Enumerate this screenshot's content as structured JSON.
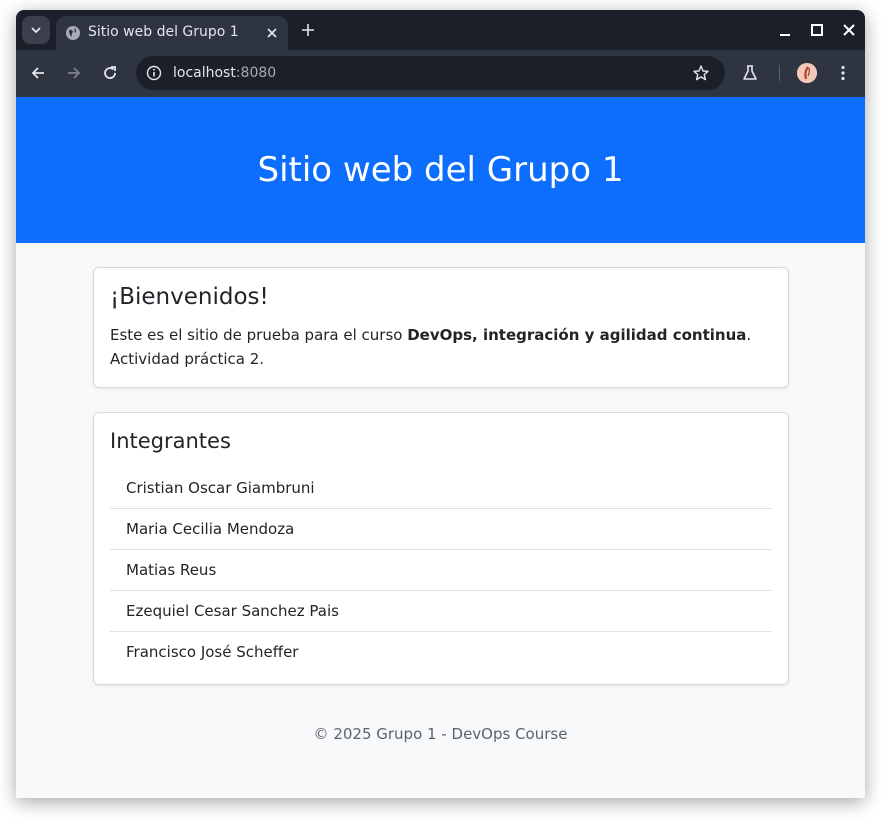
{
  "browser": {
    "tab": {
      "title": "Sitio web del Grupo 1"
    },
    "address": {
      "host": "localhost",
      "port": ":8080"
    }
  },
  "page": {
    "hero_title": "Sitio web del Grupo 1",
    "welcome": {
      "heading": "¡Bienvenidos!",
      "text_before": "Este es el sitio de prueba para el curso ",
      "course": "DevOps, integración y agilidad continua",
      "text_after": ".",
      "activity": "Actividad práctica 2."
    },
    "members": {
      "heading": "Integrantes",
      "items": [
        "Cristian Oscar Giambruni",
        "Maria Cecilia Mendoza",
        "Matias Reus",
        "Ezequiel Cesar Sanchez Pais",
        "Francisco José Scheffer"
      ]
    },
    "footer": "© 2025 Grupo 1 - DevOps Course"
  },
  "colors": {
    "hero": "#0d6efd",
    "tab_strip": "#1b1f2a",
    "toolbar": "#2f3441"
  }
}
